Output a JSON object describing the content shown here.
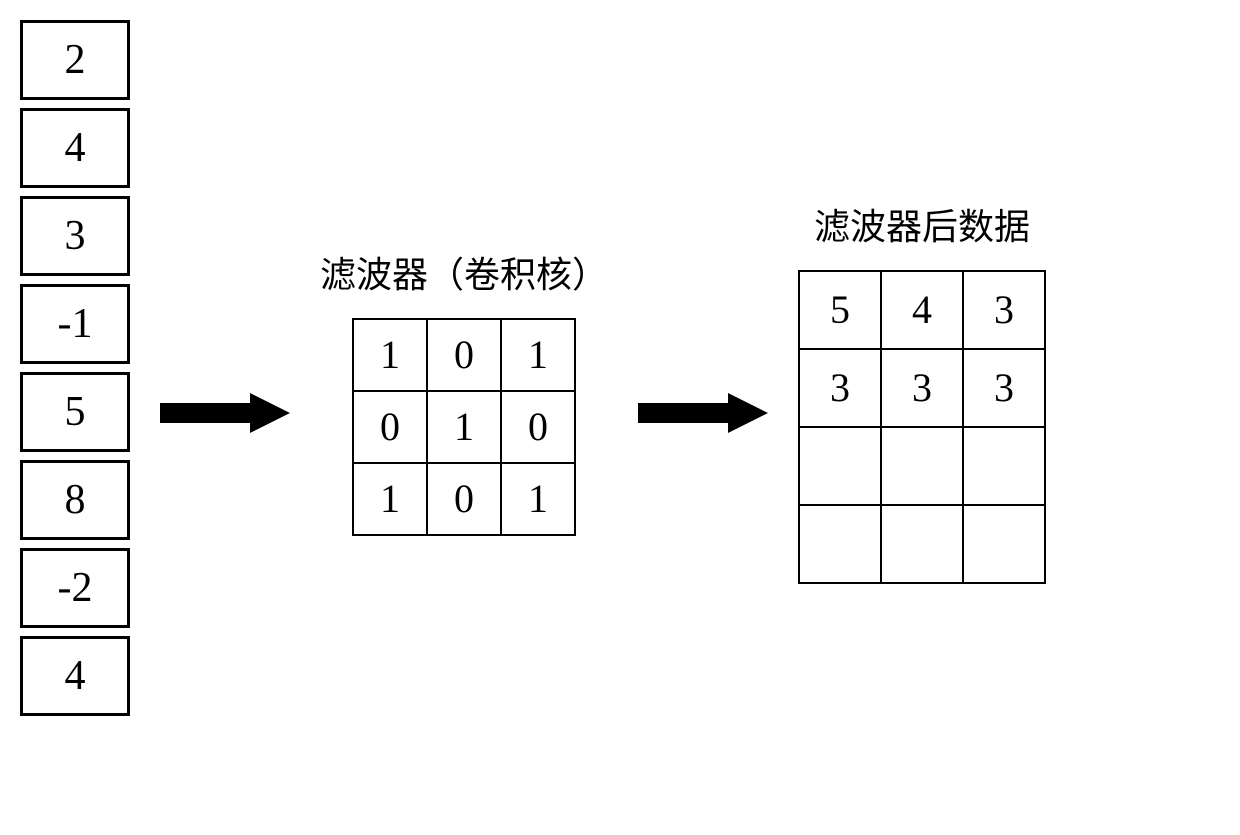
{
  "input_vector": [
    "2",
    "4",
    "3",
    "-1",
    "5",
    "8",
    "-2",
    "4"
  ],
  "filter": {
    "label": "滤波器（卷积核）",
    "grid": [
      [
        "1",
        "0",
        "1"
      ],
      [
        "0",
        "1",
        "0"
      ],
      [
        "1",
        "0",
        "1"
      ]
    ]
  },
  "output": {
    "label": "滤波器后数据",
    "grid": [
      [
        "5",
        "4",
        "3"
      ],
      [
        "3",
        "3",
        "3"
      ],
      [
        "",
        "",
        ""
      ],
      [
        "",
        "",
        ""
      ]
    ]
  }
}
